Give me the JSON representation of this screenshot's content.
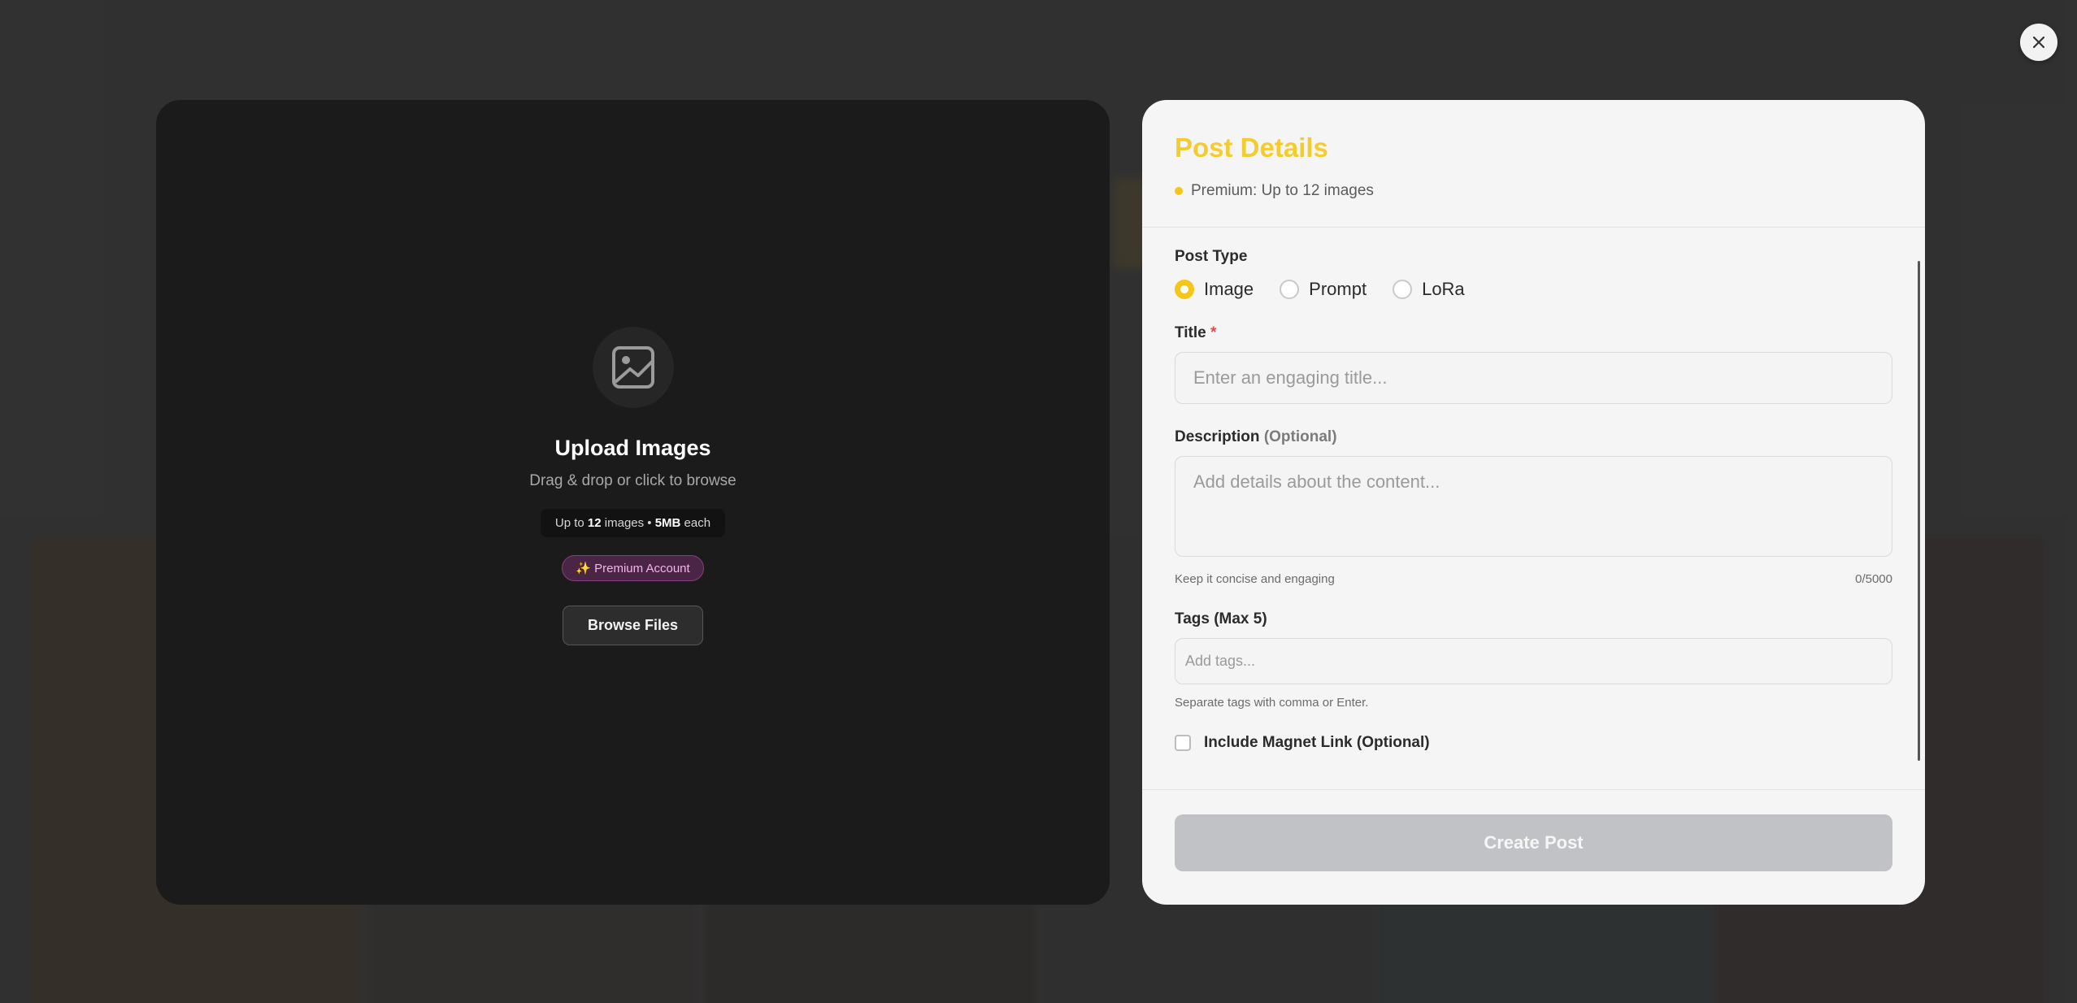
{
  "upload": {
    "title": "Upload Images",
    "subtitle": "Drag & drop or click to browse",
    "limit_prefix": "Up to ",
    "limit_count": "12",
    "limit_mid": " images • ",
    "limit_size": "5MB",
    "limit_suffix": " each",
    "badge": "✨ Premium Account",
    "browse_label": "Browse Files",
    "icon": "image-icon"
  },
  "details": {
    "title": "Post Details",
    "premium_note": "Premium: Up to 12 images",
    "post_type_label": "Post Type",
    "post_types": [
      "Image",
      "Prompt",
      "LoRa"
    ],
    "selected_post_type": "Image",
    "title_label": "Title",
    "required_mark": "*",
    "title_placeholder": "Enter an engaging title...",
    "description_label": "Description",
    "description_optional": "(Optional)",
    "description_placeholder": "Add details about the content...",
    "description_hint": "Keep it concise and engaging",
    "description_count": "0/5000",
    "tags_label": "Tags (Max 5)",
    "tags_placeholder": "Add tags...",
    "tags_hint": "Separate tags with comma or Enter.",
    "magnet_label": "Include Magnet Link (Optional)",
    "magnet_checked": false,
    "create_label": "Create Post"
  },
  "colors": {
    "accent": "#f5c518",
    "title": "#f5cc2e",
    "upload_bg": "#1b1b1b",
    "panel_bg": "#f5f5f5",
    "disabled_button": "#c1c2c6"
  }
}
